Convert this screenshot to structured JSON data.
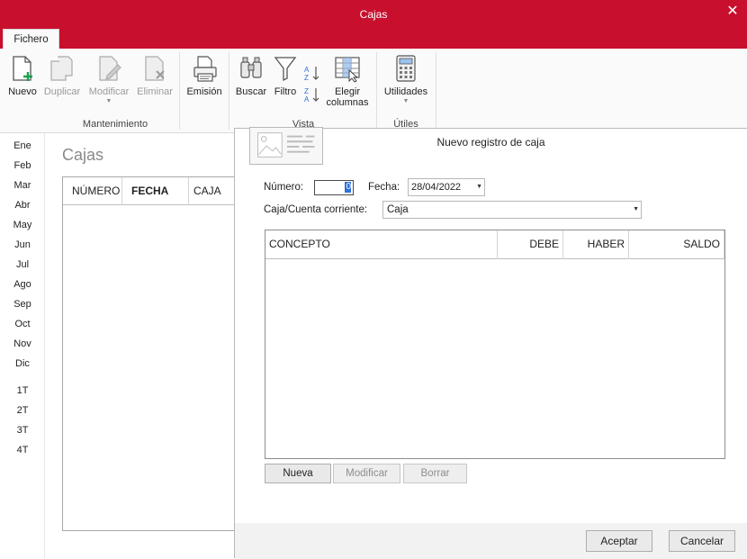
{
  "window": {
    "title": "Cajas",
    "close_glyph": "✕"
  },
  "ribbon": {
    "tab": "Fichero",
    "buttons": {
      "nuevo": "Nuevo",
      "duplicar": "Duplicar",
      "modificar": "Modificar",
      "eliminar": "Eliminar",
      "emision": "Emisión",
      "buscar": "Buscar",
      "filtro": "Filtro",
      "elegir1": "Elegir",
      "elegir2": "columnas",
      "utilidades": "Utilidades"
    },
    "groups": {
      "mantenimiento": "Mantenimiento",
      "vista": "Vista",
      "utiles": "Útiles"
    }
  },
  "months": [
    "Ene",
    "Feb",
    "Mar",
    "Abr",
    "May",
    "Jun",
    "Jul",
    "Ago",
    "Sep",
    "Oct",
    "Nov",
    "Dic"
  ],
  "quarters": [
    "1T",
    "2T",
    "3T",
    "4T"
  ],
  "list": {
    "title": "Cajas",
    "columns": [
      "NÚMERO",
      "FECHA",
      "CAJA"
    ]
  },
  "dialog": {
    "title": "Nuevo registro de caja",
    "numero_label": "Número:",
    "numero_value": "0",
    "fecha_label": "Fecha:",
    "fecha_value": "28/04/2022",
    "caja_label": "Caja/Cuenta corriente:",
    "caja_value": "Caja",
    "grid_columns": {
      "concepto": "CONCEPTO",
      "debe": "DEBE",
      "haber": "HABER",
      "saldo": "SALDO"
    },
    "buttons": {
      "nueva": "Nueva",
      "modificar": "Modificar",
      "borrar": "Borrar"
    },
    "footer": {
      "aceptar": "Aceptar",
      "cancelar": "Cancelar"
    }
  },
  "colors": {
    "brand": "#c8102e",
    "accent_blue": "#2e6fd8"
  }
}
